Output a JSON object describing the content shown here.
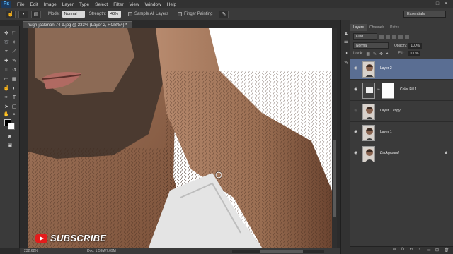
{
  "app": {
    "logo": "Ps"
  },
  "menu": [
    "File",
    "Edit",
    "Image",
    "Layer",
    "Type",
    "Select",
    "Filter",
    "View",
    "Window",
    "Help"
  ],
  "options": {
    "mode_label": "Mode:",
    "mode_value": "Normal",
    "strength_label": "Strength:",
    "strength_value": "40%",
    "sample_all_layers": "Sample All Layers",
    "finger_painting": "Finger Painting",
    "workspace": "Essentials"
  },
  "document": {
    "tab_title": "hugh-jackman-74-d.jpg @ 233% (Layer 2, RGB/8#) *"
  },
  "status": {
    "zoom": "232.62%",
    "doc": "Doc: 1.59M/7.09M"
  },
  "overlay": {
    "subscribe": "SUBSCRIBE"
  },
  "panel": {
    "tabs": [
      "Layers",
      "Channels",
      "Paths"
    ],
    "kind_filter": "Kind",
    "blend_mode": "Normal",
    "opacity_label": "Opacity:",
    "opacity_value": "100%",
    "lock_label": "Lock:",
    "fill_label": "Fill:",
    "fill_value": "100%",
    "layers": [
      {
        "name": "Layer 2",
        "selected": true
      },
      {
        "name": "Color Fill 1",
        "selected": false
      },
      {
        "name": "Layer 1 copy",
        "selected": false
      },
      {
        "name": "Layer 1",
        "selected": false
      },
      {
        "name": "Background",
        "selected": false,
        "locked": true
      }
    ]
  },
  "colors": {
    "selected_layer": "#5a6e93",
    "ui_bg": "#3a3a3a",
    "ps_blue": "#57b3f5"
  },
  "icons": [
    "smudge-tool-icon",
    "eye-icon",
    "lock-icon",
    "link-icon",
    "youtube-icon"
  ]
}
